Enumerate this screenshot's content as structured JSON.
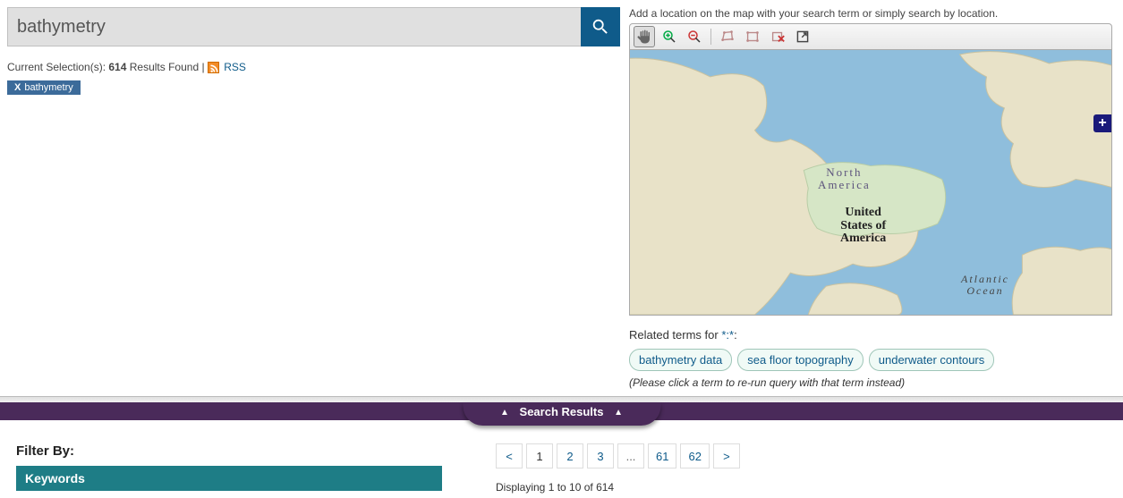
{
  "search": {
    "value": "bathymetry"
  },
  "selection": {
    "prefix": "Current Selection(s): ",
    "count": "614",
    "suffix": " Results Found | ",
    "rss_label": "RSS"
  },
  "filter_chip": {
    "x": "X",
    "label": "bathymetry"
  },
  "map": {
    "hint": "Add a location on the map with your search term or simply search by location.",
    "labels": {
      "north_america_1": "North",
      "north_america_2": "America",
      "usa_1": "United",
      "usa_2": "States of",
      "usa_3": "America",
      "atlantic_1": "Atlantic",
      "atlantic_2": "Ocean"
    },
    "plus": "+"
  },
  "related": {
    "prefix": "Related terms for ",
    "query": "*:*",
    "suffix": ":",
    "terms": [
      "bathymetry data",
      "sea floor topography",
      "underwater contours"
    ],
    "note": "(Please click a term to re-run query with that term instead)"
  },
  "results_bar": {
    "label": "Search Results"
  },
  "filter": {
    "heading": "Filter By:",
    "facet": "Keywords"
  },
  "pagination": {
    "prev": "<",
    "pages": [
      "1",
      "2",
      "3",
      "...",
      "61",
      "62"
    ],
    "next": ">",
    "current": "1"
  },
  "display_line": "Displaying 1 to 10 of 614"
}
